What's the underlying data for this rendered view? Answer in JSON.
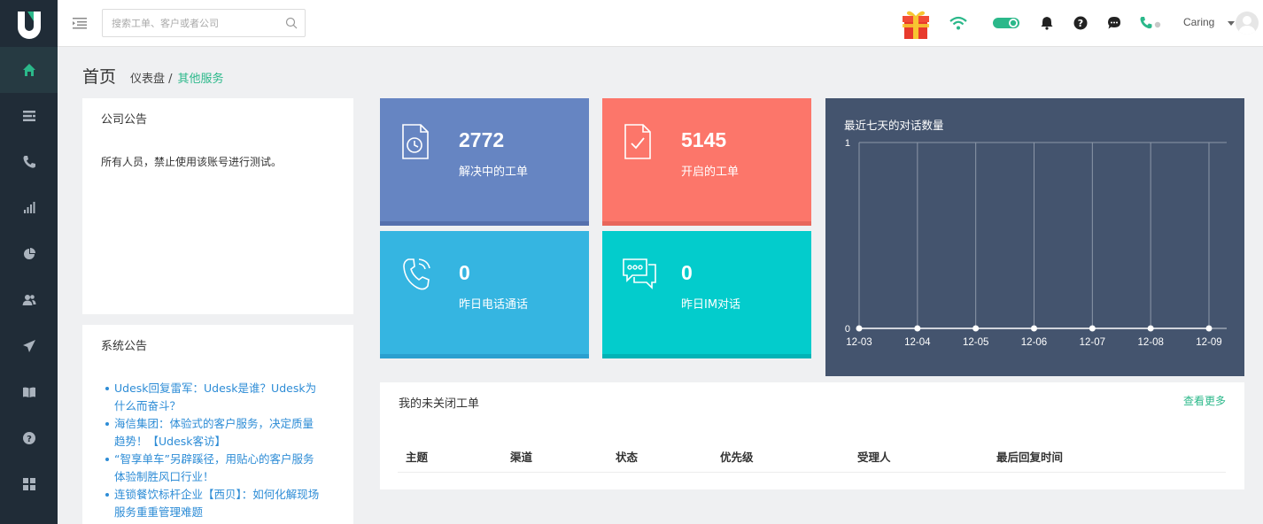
{
  "search": {
    "placeholder": "搜索工单、客户或者公司"
  },
  "user": {
    "name": "Caring"
  },
  "breadcrumb": {
    "title": "首页",
    "parent": "仪表盘 /",
    "current": "其他服务"
  },
  "company_notice": {
    "title": "公司公告",
    "text": "所有人员，禁止使用该账号进行测试。"
  },
  "system_notice": {
    "title": "系统公告",
    "items": [
      "Udesk回复雷军：Udesk是谁？Udesk为什么而奋斗？",
      "海信集团：体验式的客户服务，决定质量趋势！【Udesk客访】",
      "“智享单车”另辟蹊径，用贴心的客户服务体验制胜风口行业！",
      "连锁餐饮标杆企业【西贝】：如何化解现场服务重重管理难题"
    ]
  },
  "stats": [
    {
      "value": "2772",
      "label": "解决中的工单",
      "icon": "clock-document-icon",
      "color": "#6685c2",
      "bar": "#5570ad"
    },
    {
      "value": "5145",
      "label": "开启的工单",
      "icon": "check-document-icon",
      "color": "#fc766a",
      "bar": "#e8665b"
    },
    {
      "value": "0",
      "label": "昨日电话通话",
      "icon": "phone-call-icon",
      "color": "#35b5e1",
      "bar": "#2a9fcf"
    },
    {
      "value": "0",
      "label": "昨日IM对话",
      "icon": "chat-bubbles-icon",
      "color": "#03cccc",
      "bar": "#02b3b6"
    }
  ],
  "chart_data": {
    "type": "line",
    "title": "最近七天的对话数量",
    "categories": [
      "12-03",
      "12-04",
      "12-05",
      "12-06",
      "12-07",
      "12-08",
      "12-09"
    ],
    "values": [
      0,
      0,
      0,
      0,
      0,
      0,
      0
    ],
    "ylim": [
      0,
      1
    ],
    "yticks": [
      "0",
      "1"
    ],
    "grid": true,
    "colors": {
      "background": "#44546e",
      "line": "#ffffff"
    }
  },
  "tickets": {
    "title": "我的未关闭工单",
    "more": "查看更多",
    "columns": [
      "主题",
      "渠道",
      "状态",
      "优先级",
      "受理人",
      "最后回复时间"
    ]
  },
  "theme": {
    "accent": "#2bb88a",
    "sidebar": "#202c37"
  }
}
